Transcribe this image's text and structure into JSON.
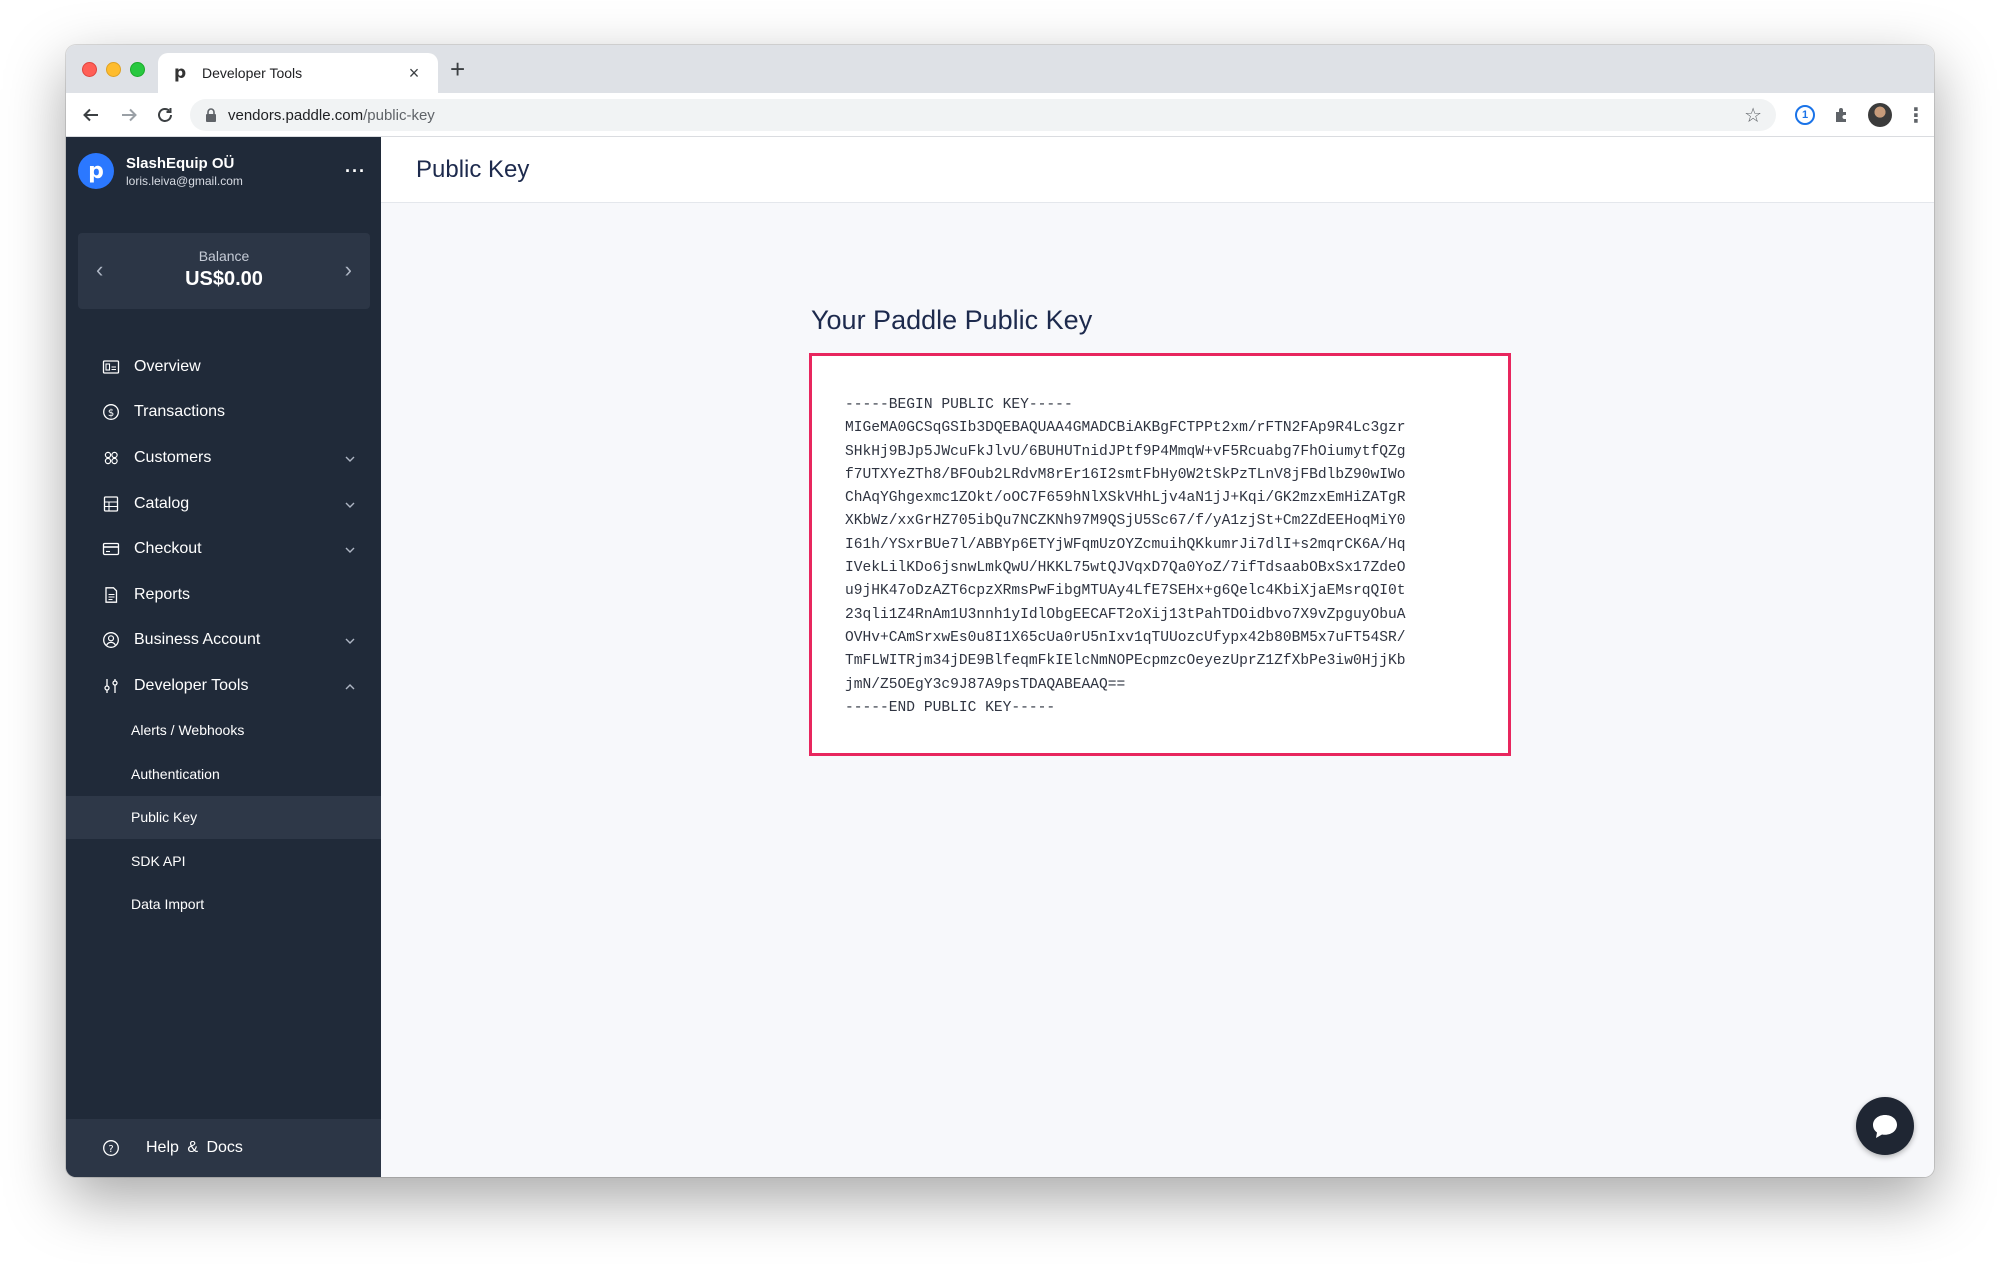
{
  "browser": {
    "tab_title": "Developer Tools",
    "tab_favicon": "p",
    "url_host": "vendors.paddle.com",
    "url_path": "/public-key"
  },
  "sidebar": {
    "account_logo": "p",
    "account_name": "SlashEquip OÜ",
    "account_email": "loris.leiva@gmail.com",
    "more": "···",
    "balance_label": "Balance",
    "balance_value": "US$0.00",
    "items": [
      {
        "label": "Overview",
        "icon": "overview-icon"
      },
      {
        "label": "Transactions",
        "icon": "dollar-icon"
      },
      {
        "label": "Customers",
        "icon": "customers-icon",
        "chevron": "down"
      },
      {
        "label": "Catalog",
        "icon": "catalog-icon",
        "chevron": "down"
      },
      {
        "label": "Checkout",
        "icon": "card-icon",
        "chevron": "down"
      },
      {
        "label": "Reports",
        "icon": "reports-icon"
      },
      {
        "label": "Business Account",
        "icon": "account-icon",
        "chevron": "down"
      },
      {
        "label": "Developer Tools",
        "icon": "sliders-icon",
        "chevron": "up"
      }
    ],
    "subitems": [
      "Alerts / Webhooks",
      "Authentication",
      "Public Key",
      "SDK API",
      "Data Import"
    ],
    "active_subitem": "Public Key",
    "help_label": "Help & Docs"
  },
  "main": {
    "page_title": "Public Key",
    "key_heading": "Your Paddle Public Key",
    "key_lines": [
      "-----BEGIN PUBLIC KEY-----",
      "MIGeMA0GCSqGSIb3DQEBAQUAA4GMADCBiAKBgFCTPPt2xm/rFTN2FAp9R4Lc3gzr",
      "SHkHj9BJp5JWcuFkJlvU/6BUHUTnidJPtf9P4MmqW+vF5Rcuabg7FhOiumytfQZg",
      "f7UTXYeZTh8/BFOub2LRdvM8rEr16I2smtFbHy0W2tSkPzTLnV8jFBdlbZ90wIWo",
      "ChAqYGhgexmc1ZOkt/oOC7F659hNlXSkVHhLjv4aN1jJ+Kqi/GK2mzxEmHiZATgR",
      "XKbWz/xxGrHZ705ibQu7NCZKNh97M9QSjU5Sc67/f/yA1zjSt+Cm2ZdEEHoqMiY0",
      "I61h/YSxrBUe7l/ABBYp6ETYjWFqmUzOYZcmuihQKkumrJi7dlI+s2mqrCK6A/Hq",
      "IVekLilKDo6jsnwLmkQwU/HKKL75wtQJVqxD7Qa0YoZ/7ifTdsaabOBxSx17ZdeO",
      "u9jHK47oDzAZT6cpzXRmsPwFibgMTUAy4LfE7SEHx+g6Qelc4KbiXjaEMsrqQI0t",
      "23qli1Z4RnAm1U3nnh1yIdlObgEECAFT2oXij13tPahTDOidbvo7X9vZpguyObuA",
      "OVHv+CAmSrxwEs0u8I1X65cUa0rU5nIxv1qTUUozcUfypx42b80BM5x7uFT54SR/",
      "TmFLWITRjm34jDE9BlfeqmFkIElcNmNOPEcpmzcOeyezUprZ1ZfXbPe3iw0HjjKb",
      "jmN/Z5OEgY3c9J87A9psTDAQABEAAQ==",
      "-----END PUBLIC KEY-----"
    ]
  },
  "colors": {
    "sidebar_bg": "#202a39",
    "highlight_border": "#e8265e",
    "accent_blue": "#2b78ff"
  }
}
